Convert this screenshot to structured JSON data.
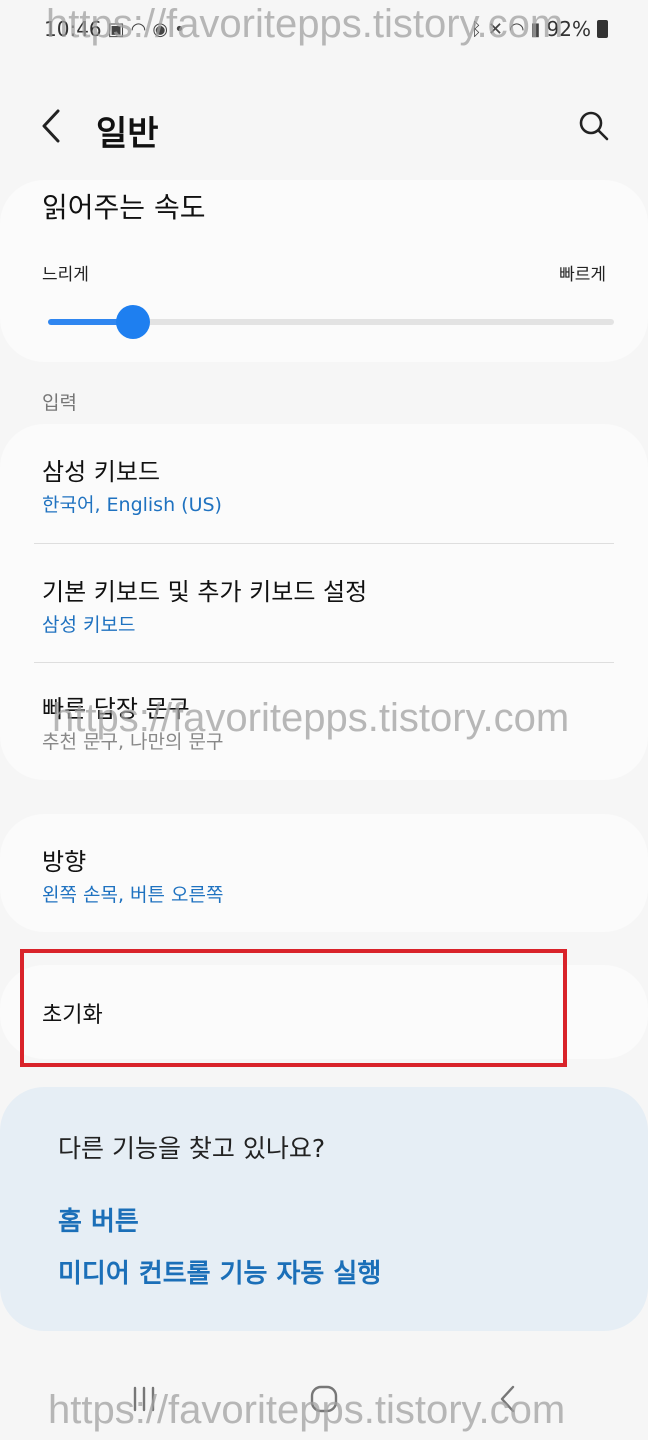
{
  "status_bar": {
    "time": "10:46",
    "battery": "92%"
  },
  "header": {
    "title": "일반"
  },
  "speed": {
    "title": "읽어주는 속도",
    "min_label": "느리게",
    "max_label": "빠르게",
    "value": 0.15
  },
  "input_section": {
    "label": "입력",
    "items": [
      {
        "title": "삼성 키보드",
        "subtitle": "한국어, English (US)"
      },
      {
        "title": "기본 키보드 및 추가 키보드 설정",
        "subtitle": "삼성 키보드"
      },
      {
        "title": "빠른 답장 문구",
        "subtitle": "추천 문구, 나만의 문구"
      }
    ]
  },
  "direction": {
    "title": "방향",
    "subtitle": "왼쪽 손목, 버튼 오른쪽"
  },
  "reset": {
    "title": "초기화"
  },
  "suggestions": {
    "title": "다른 기능을 찾고 있나요?",
    "links": [
      "홈 버튼",
      "미디어 컨트롤 기능 자동 실행"
    ]
  },
  "watermark": "https://favoritepps.tistory.com",
  "colors": {
    "accent": "#1e7ff0",
    "link": "#1b6fb8",
    "highlight": "#d9232a"
  }
}
